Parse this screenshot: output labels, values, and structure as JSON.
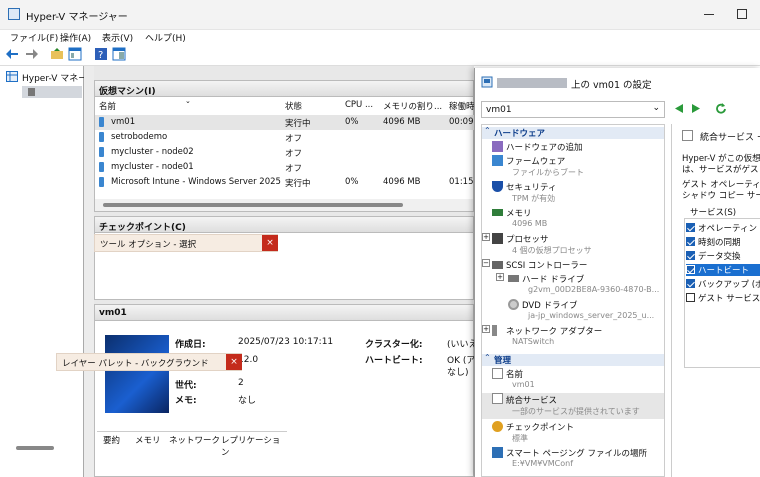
{
  "app": {
    "title": "Hyper-V マネージャー"
  },
  "menu": [
    "ファイル(F)",
    "操作(A)",
    "表示(V)",
    "ヘルプ(H)"
  ],
  "tree": {
    "root": "Hyper-V マネー"
  },
  "vms": {
    "header": "仮想マシン(I)",
    "columns": [
      "名前",
      "状態",
      "CPU ...",
      "メモリの割り...",
      "稼働時"
    ],
    "rows": [
      {
        "name": "vm01",
        "state": "実行中",
        "cpu": "0%",
        "mem": "4096 MB",
        "up": "00:09:"
      },
      {
        "name": "setrobodemo",
        "state": "オフ",
        "cpu": "",
        "mem": "",
        "up": ""
      },
      {
        "name": "mycluster - node02",
        "state": "オフ",
        "cpu": "",
        "mem": "",
        "up": ""
      },
      {
        "name": "mycluster - node01",
        "state": "オフ",
        "cpu": "",
        "mem": "",
        "up": ""
      },
      {
        "name": "Microsoft Intune - Windows Server 2025",
        "state": "実行中",
        "cpu": "0%",
        "mem": "4096 MB",
        "up": "01:15:"
      }
    ]
  },
  "checkpoints": {
    "header": "チェックポイント(C)",
    "tooltip": "ツール オプション - 選択"
  },
  "details": {
    "header": "vm01",
    "created_label": "作成日:",
    "created_value": "2025/07/23 10:17:11",
    "version_value": "12.0",
    "gen_label": "世代:",
    "gen_value": "2",
    "memo_label": "メモ:",
    "memo_value": "なし",
    "cluster_label": "クラスター化:",
    "cluster_value": "(いいえ",
    "heartbeat_label": "ハートビート:",
    "heartbeat_value": "OK (ア",
    "heartbeat_value2": "なし)",
    "tooltip": "レイヤー パレット - バックグラウンド",
    "tabs": [
      "要約",
      "メモリ",
      "ネットワーク",
      "レプリケーション"
    ]
  },
  "dialog": {
    "title": "上の vm01 の設定",
    "vm_select": "vm01",
    "sec_hw": "ハードウェア",
    "items": {
      "add_hw": "ハードウェアの追加",
      "firmware": "ファームウェア",
      "firmware_sub": "ファイルからブート",
      "security": "セキュリティ",
      "security_sub": "TPM が有効",
      "memory": "メモリ",
      "memory_sub": "4096 MB",
      "cpu": "プロセッサ",
      "cpu_sub": "4 個の仮想プロセッサ",
      "scsi": "SCSI コントローラー",
      "hdd": "ハード ドライブ",
      "hdd_sub": "g2vm_00D2BE8A-9360-4870-B...",
      "dvd": "DVD ドライブ",
      "dvd_sub": "ja-jp_windows_server_2025_u...",
      "nic": "ネットワーク アダプター",
      "nic_sub": "NATSwitch"
    },
    "sec_mgmt": "管理",
    "mgmt": {
      "name": "名前",
      "name_sub": "vm01",
      "integ": "統合サービス",
      "integ_sub": "一部のサービスが提供されています",
      "cp": "チェックポイント",
      "cp_sub": "標準",
      "paging": "スマート ページング ファイルの場所",
      "paging_sub": "E:¥VM¥VMConf"
    },
    "right": {
      "title": "統合サービス ー",
      "desc1": "Hyper-V がこの仮想",
      "desc2": "は、サービスがゲスト",
      "desc3": "ゲスト オペレーティン",
      "desc4": "シャドウ コピー サービ",
      "services_label": "サービス(S)",
      "services": [
        {
          "label": "オペレーティン",
          "checked": true
        },
        {
          "label": "時刻の同期",
          "checked": true
        },
        {
          "label": "データ交換",
          "checked": true
        },
        {
          "label": "ハートビート",
          "checked": true
        },
        {
          "label": "バックアップ (ボ",
          "checked": true
        },
        {
          "label": "ゲスト サービス",
          "checked": false
        }
      ]
    }
  }
}
